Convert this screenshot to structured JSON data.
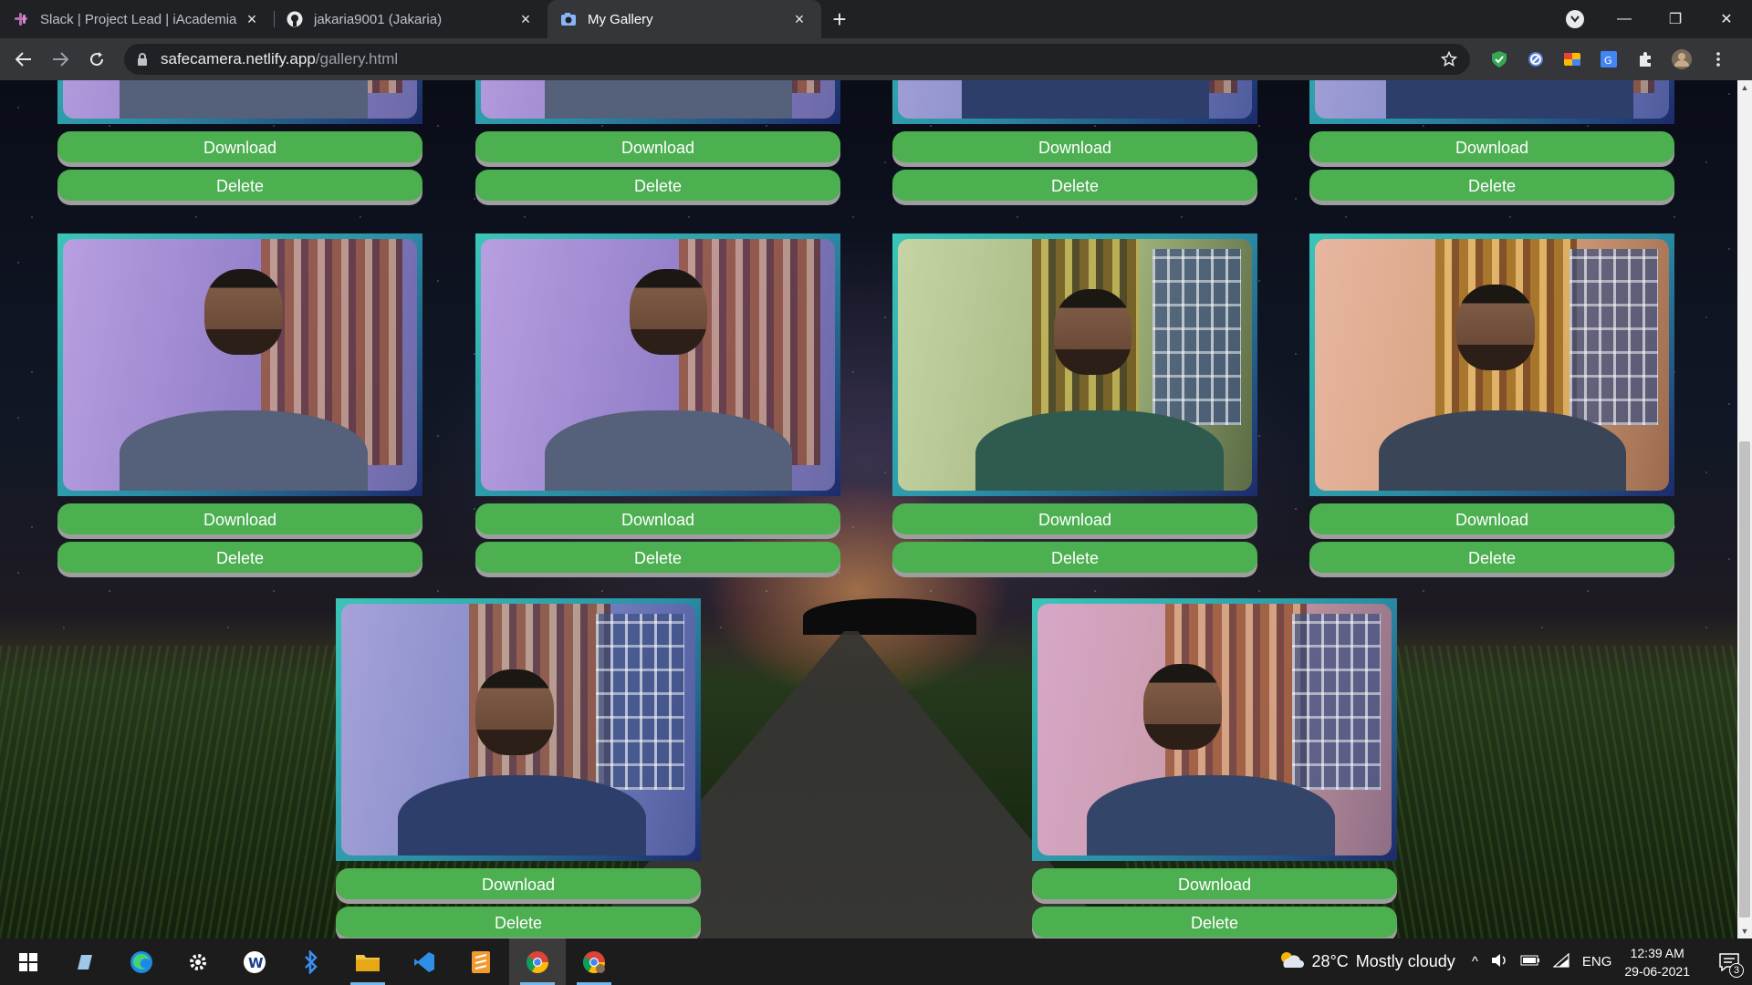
{
  "browser": {
    "tabs": [
      {
        "title": "Slack | Project Lead | iAcademia",
        "icon": "slack-icon",
        "active": false
      },
      {
        "title": "jakaria9001 (Jakaria)",
        "icon": "github-icon",
        "active": false
      },
      {
        "title": "My Gallery",
        "icon": "gallery-favicon",
        "active": true
      }
    ],
    "url_host": "safecamera.netlify.app",
    "url_path": "/gallery.html"
  },
  "gallery": {
    "download_label": "Download",
    "delete_label": "Delete",
    "photo_count_visible": 10
  },
  "taskbar": {
    "weather_temp": "28°C",
    "weather_text": "Mostly cloudy",
    "language": "ENG",
    "time": "12:39 AM",
    "date": "29-06-2021",
    "notification_count": "3"
  }
}
